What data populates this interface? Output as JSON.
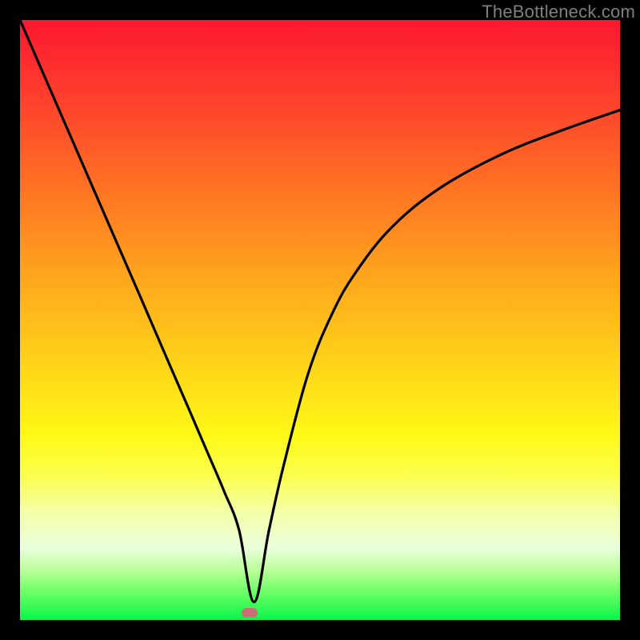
{
  "watermark": "TheBottleneck.com",
  "chart_data": {
    "type": "line",
    "title": "",
    "xlabel": "",
    "ylabel": "",
    "xlim": [
      0,
      100
    ],
    "ylim": [
      0,
      100
    ],
    "grid": false,
    "legend": false,
    "background_gradient": {
      "direction": "vertical",
      "stops": [
        {
          "pos": 0.0,
          "color": "#fd1730"
        },
        {
          "pos": 0.5,
          "color": "#ffc11b"
        },
        {
          "pos": 0.8,
          "color": "#f8ff70"
        },
        {
          "pos": 1.0,
          "color": "#0cf34a"
        }
      ]
    },
    "series": [
      {
        "name": "bottleneck-curve",
        "x": [
          0.0,
          5.0,
          10.0,
          15.0,
          20.0,
          25.0,
          28.0,
          31.0,
          34.0,
          36.5,
          39.0,
          41.5,
          44.0,
          48.0,
          52.0,
          56.0,
          62.0,
          70.0,
          80.0,
          90.0,
          100.0
        ],
        "y": [
          100.0,
          88.5,
          77.0,
          65.5,
          54.0,
          42.4,
          35.5,
          28.5,
          21.5,
          15.0,
          3.0,
          15.0,
          26.0,
          41.0,
          51.0,
          58.0,
          65.5,
          72.0,
          77.5,
          81.5,
          85.0
        ]
      }
    ],
    "markers": [
      {
        "name": "optimal-point",
        "x": 38.2,
        "y": 1.2,
        "color": "#cc6e76"
      }
    ]
  }
}
